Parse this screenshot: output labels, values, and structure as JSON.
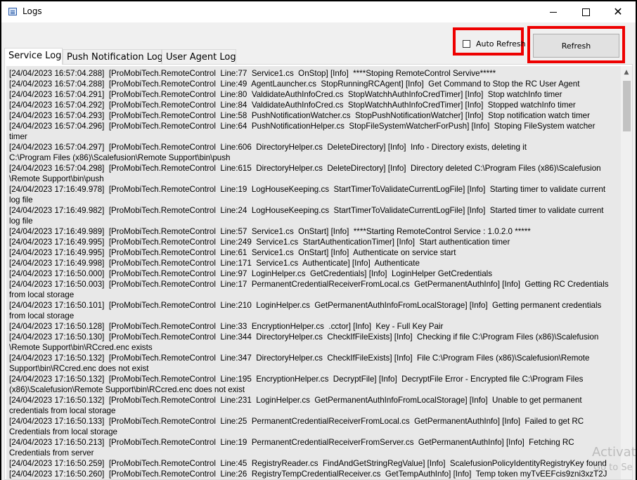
{
  "window": {
    "title": "Logs",
    "controls": {
      "minimize": "–",
      "maximize": "☐",
      "close": "✕"
    }
  },
  "toolbar": {
    "auto_refresh_label": "Auto Refresh",
    "auto_refresh_checked": false,
    "refresh_label": "Refresh",
    "highlight_color": "#ee0000"
  },
  "tabs": [
    {
      "label": "Service Log",
      "active": true
    },
    {
      "label": "Push Notification Log",
      "active": false
    },
    {
      "label": "User Agent Log",
      "active": false
    }
  ],
  "log_lines": [
    "[24/04/2023 16:57:04.288]  [ProMobiTech.RemoteControl  Line:77  Service1.cs  OnStop] [Info]  ****Stoping RemoteControl Servive*****",
    "[24/04/2023 16:57:04.288]  [ProMobiTech.RemoteControl  Line:49  AgentLauncher.cs  StopRunningRCAgent] [Info]  Get Command to Stop the RC User Agent",
    "[24/04/2023 16:57:04.291]  [ProMobiTech.RemoteControl  Line:80  ValdidateAuthInfoCred.cs  StopWatchhAuthInfoCredTimer] [Info]  Stop watchInfo timer",
    "[24/04/2023 16:57:04.292]  [ProMobiTech.RemoteControl  Line:84  ValdidateAuthInfoCred.cs  StopWatchhAuthInfoCredTimer] [Info]  Stopped watchInfo timer",
    "[24/04/2023 16:57:04.293]  [ProMobiTech.RemoteControl  Line:58  PushNotificationWatcher.cs  StopPushNotificationWatcher] [Info]  Stop notification watch timer",
    "[24/04/2023 16:57:04.296]  [ProMobiTech.RemoteControl  Line:64  PushNotificationHelper.cs  StopFileSystemWatcherForPush] [Info]  Stoping FileSystem watcher\ntimer",
    "[24/04/2023 16:57:04.297]  [ProMobiTech.RemoteControl  Line:606  DirectoryHelper.cs  DeleteDirectory] [Info]  Info - Directory exists, deleting it\nC:\\Program Files (x86)\\Scalefusion\\Remote Support\\bin\\push",
    "[24/04/2023 16:57:04.298]  [ProMobiTech.RemoteControl  Line:615  DirectoryHelper.cs  DeleteDirectory] [Info]  Directory deleted C:\\Program Files (x86)\\Scalefusion\n\\Remote Support\\bin\\push",
    "[24/04/2023 17:16:49.978]  [ProMobiTech.RemoteControl  Line:19  LogHouseKeeping.cs  StartTimerToValidateCurrentLogFile] [Info]  Starting timer to validate current\nlog file",
    "[24/04/2023 17:16:49.982]  [ProMobiTech.RemoteControl  Line:24  LogHouseKeeping.cs  StartTimerToValidateCurrentLogFile] [Info]  Started timer to validate current\nlog file",
    "[24/04/2023 17:16:49.989]  [ProMobiTech.RemoteControl  Line:57  Service1.cs  OnStart] [Info]  ****Starting RemoteControl Service : 1.0.2.0 *****",
    "[24/04/2023 17:16:49.995]  [ProMobiTech.RemoteControl  Line:249  Service1.cs  StartAuthenticationTimer] [Info]  Start authentication timer",
    "[24/04/2023 17:16:49.995]  [ProMobiTech.RemoteControl  Line:61  Service1.cs  OnStart] [Info]  Authenticate on service start",
    "[24/04/2023 17:16:49.998]  [ProMobiTech.RemoteControl  Line:171  Service1.cs  Authenticate] [Info]  Authenticate",
    "[24/04/2023 17:16:50.000]  [ProMobiTech.RemoteControl  Line:97  LoginHelper.cs  GetCredentials] [Info]  LoginHelper GetCredentials",
    "[24/04/2023 17:16:50.003]  [ProMobiTech.RemoteControl  Line:17  PermanentCredentialReceiverFromLocal.cs  GetPermanentAuthInfo] [Info]  Getting RC Credentials\nfrom local storage",
    "[24/04/2023 17:16:50.101]  [ProMobiTech.RemoteControl  Line:210  LoginHelper.cs  GetPermanentAuthInfoFromLocalStorage] [Info]  Getting permanent credentials\nfrom local storage",
    "[24/04/2023 17:16:50.128]  [ProMobiTech.RemoteControl  Line:33  EncryptionHelper.cs  .cctor] [Info]  Key - Full Key Pair",
    "[24/04/2023 17:16:50.130]  [ProMobiTech.RemoteControl  Line:344  DirectoryHelper.cs  CheckIfFileExists] [Info]  Checking if file C:\\Program Files (x86)\\Scalefusion\n\\Remote Support\\bin\\RCcred.enc exists",
    "[24/04/2023 17:16:50.132]  [ProMobiTech.RemoteControl  Line:347  DirectoryHelper.cs  CheckIfFileExists] [Info]  File C:\\Program Files (x86)\\Scalefusion\\Remote\nSupport\\bin\\RCcred.enc does not exist",
    "[24/04/2023 17:16:50.132]  [ProMobiTech.RemoteControl  Line:195  EncryptionHelper.cs  DecryptFile] [Info]  DecryptFile Error - Encrypted file C:\\Program Files\n(x86)\\Scalefusion\\Remote Support\\bin\\RCcred.enc does not exist",
    "[24/04/2023 17:16:50.132]  [ProMobiTech.RemoteControl  Line:231  LoginHelper.cs  GetPermanentAuthInfoFromLocalStorage] [Info]  Unable to get permanent\ncredentials from local storage",
    "[24/04/2023 17:16:50.133]  [ProMobiTech.RemoteControl  Line:25  PermanentCredentialReceiverFromLocal.cs  GetPermanentAuthInfo] [Info]  Failed to get RC\nCredentials from local storage",
    "[24/04/2023 17:16:50.213]  [ProMobiTech.RemoteControl  Line:19  PermanentCredentialReceiverFromServer.cs  GetPermanentAuthInfo] [Info]  Fetching RC\nCredentials from server",
    "[24/04/2023 17:16:50.259]  [ProMobiTech.RemoteControl  Line:45  RegistryReader.cs  FindAndGetStringRegValue] [Info]  ScalefusionPolicyIdentityRegistryKey found",
    "[24/04/2023 17:16:50.260]  [ProMobiTech.RemoteControl  Line:26  RegistryTempCredentialReceiver.cs  GetTempAuthInfo] [Info]  Temp token myTvEEFcis9zni3xzT2J"
  ],
  "watermark": {
    "line1": "Activat",
    "line2": "Go to Se"
  }
}
